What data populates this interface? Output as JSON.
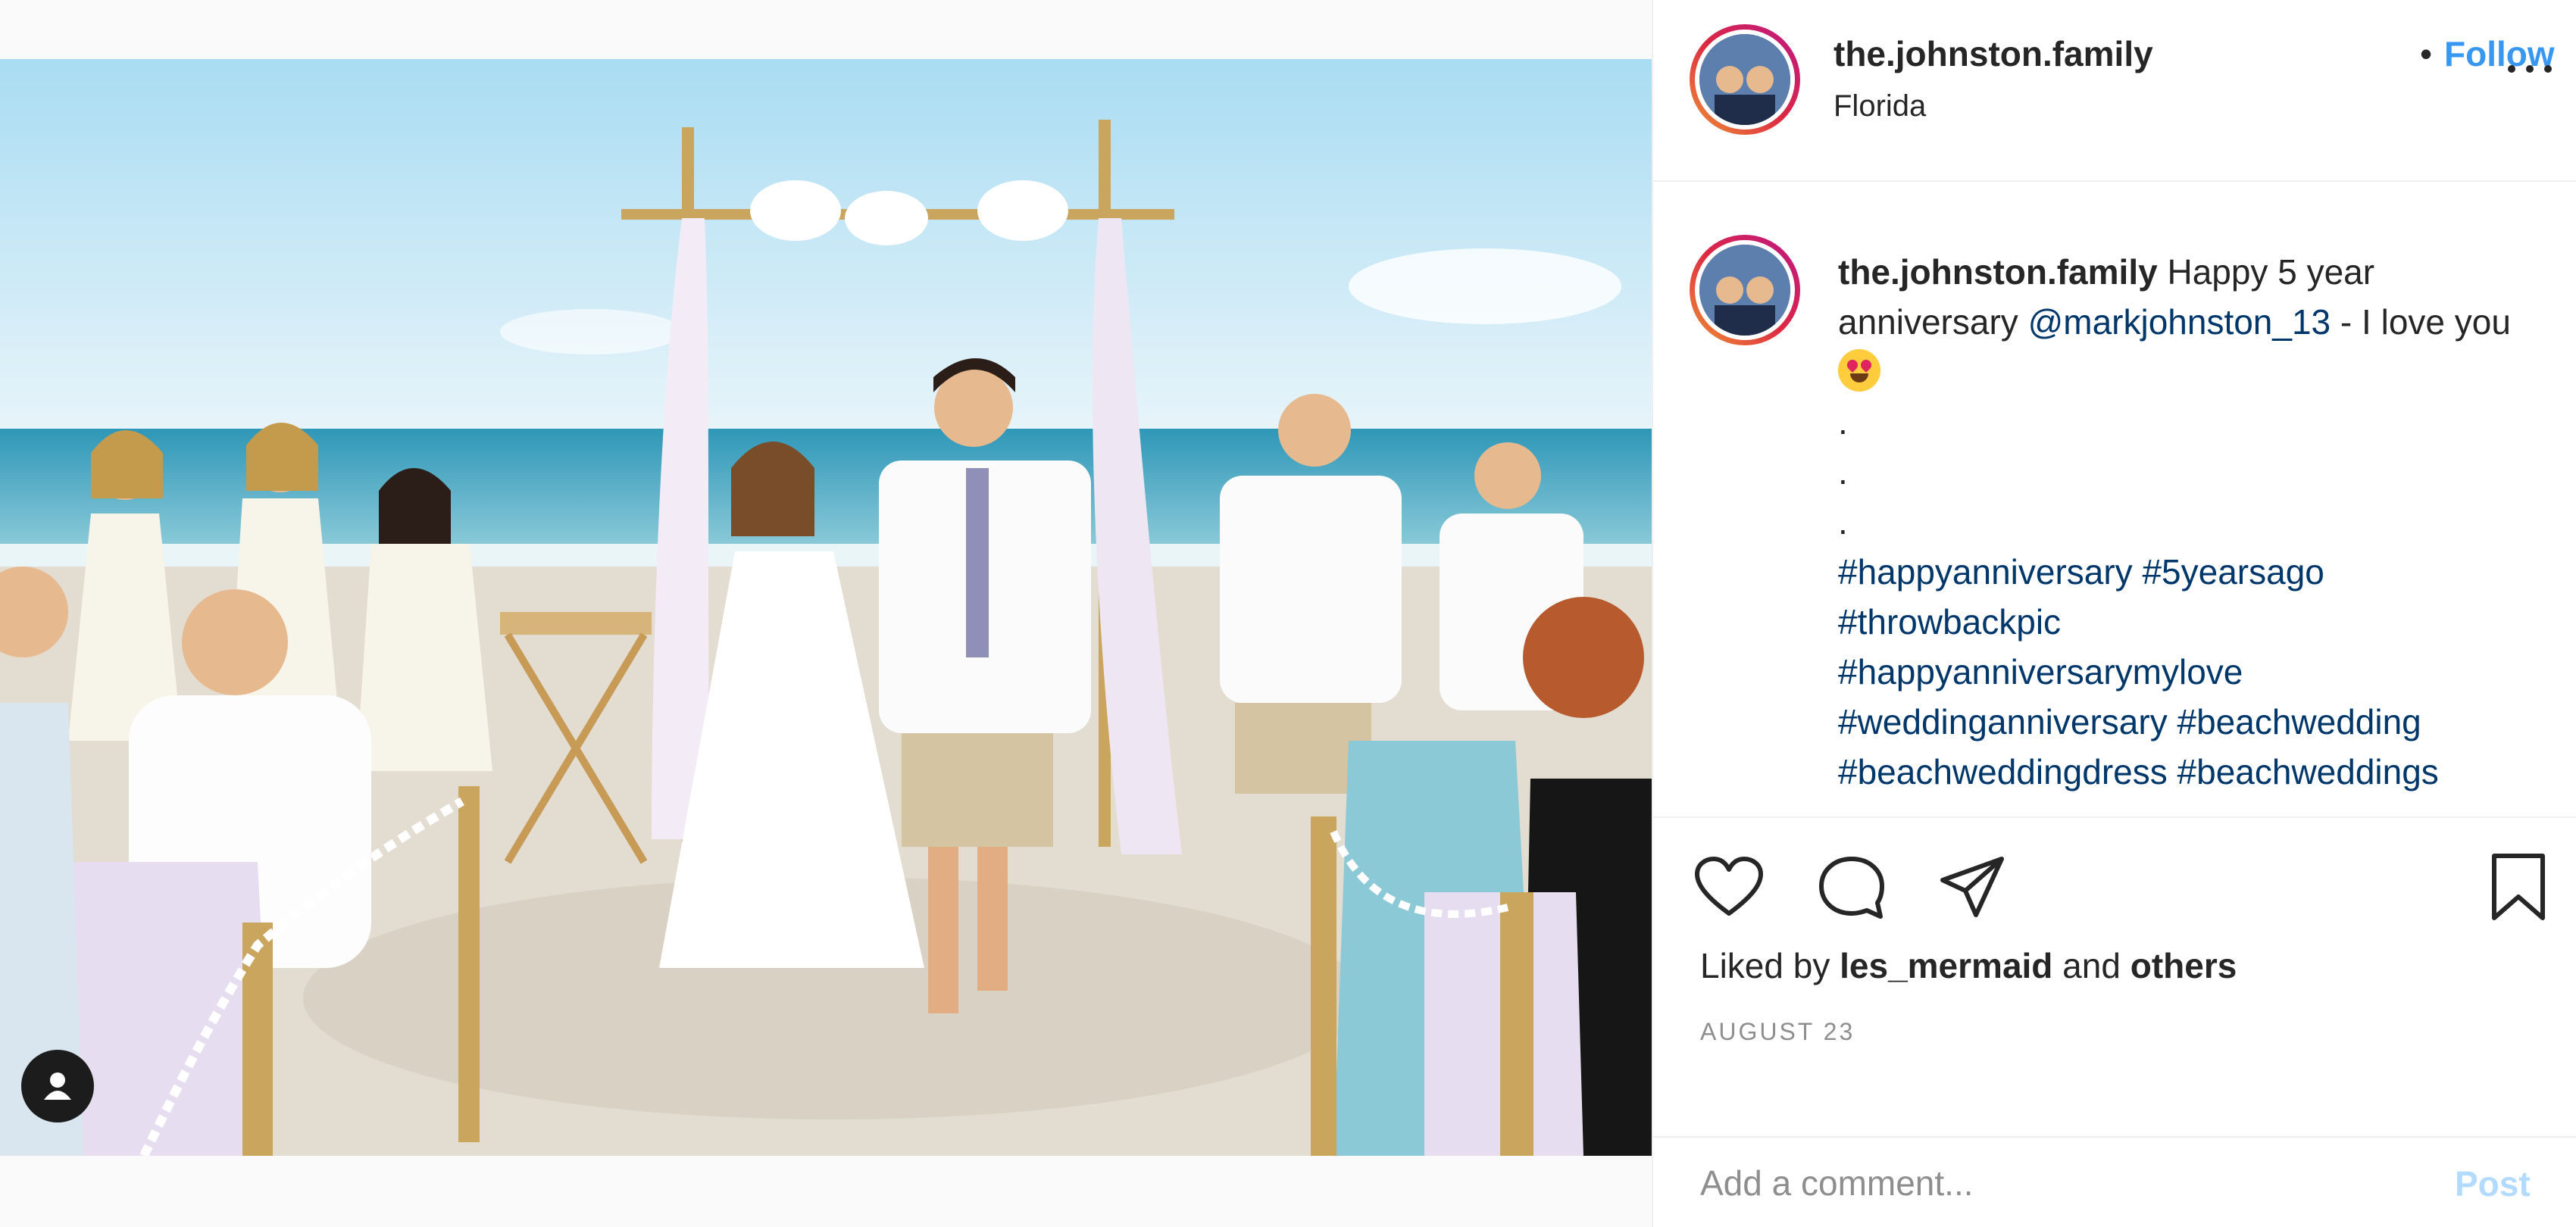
{
  "post": {
    "username": "the.johnston.family",
    "separator": "•",
    "follow_label": "Follow",
    "location": "Florida",
    "more_icon": "more-horizontal-icon",
    "caption": {
      "username": "the.johnston.family",
      "text_before_mention": " Happy 5 year anniversary ",
      "mention": "@markjohnston_13",
      "text_after_mention": " - I love you ",
      "emoji": "heart-eyes-emoji",
      "dots": [
        ".",
        ".",
        "."
      ],
      "hashtags_line1": "#happyanniversary #5yearsago",
      "hashtags_line2": "#throwbackpic",
      "hashtags_line3": "#happyanniversarymylove",
      "hashtags_line4": "#weddinganniversary #beachwedding",
      "hashtags_line5": "#beachweddingdress #beachweddings"
    },
    "likes": {
      "prefix": "Liked by ",
      "user": "les_mermaid",
      "middle": " and ",
      "others": "others"
    },
    "date": "AUGUST 23",
    "comment": {
      "placeholder": "Add a comment...",
      "post_label": "Post"
    }
  },
  "colors": {
    "link_blue": "#3897f0",
    "post_disabled": "#b3dbff",
    "hashtag": "#00376b"
  }
}
